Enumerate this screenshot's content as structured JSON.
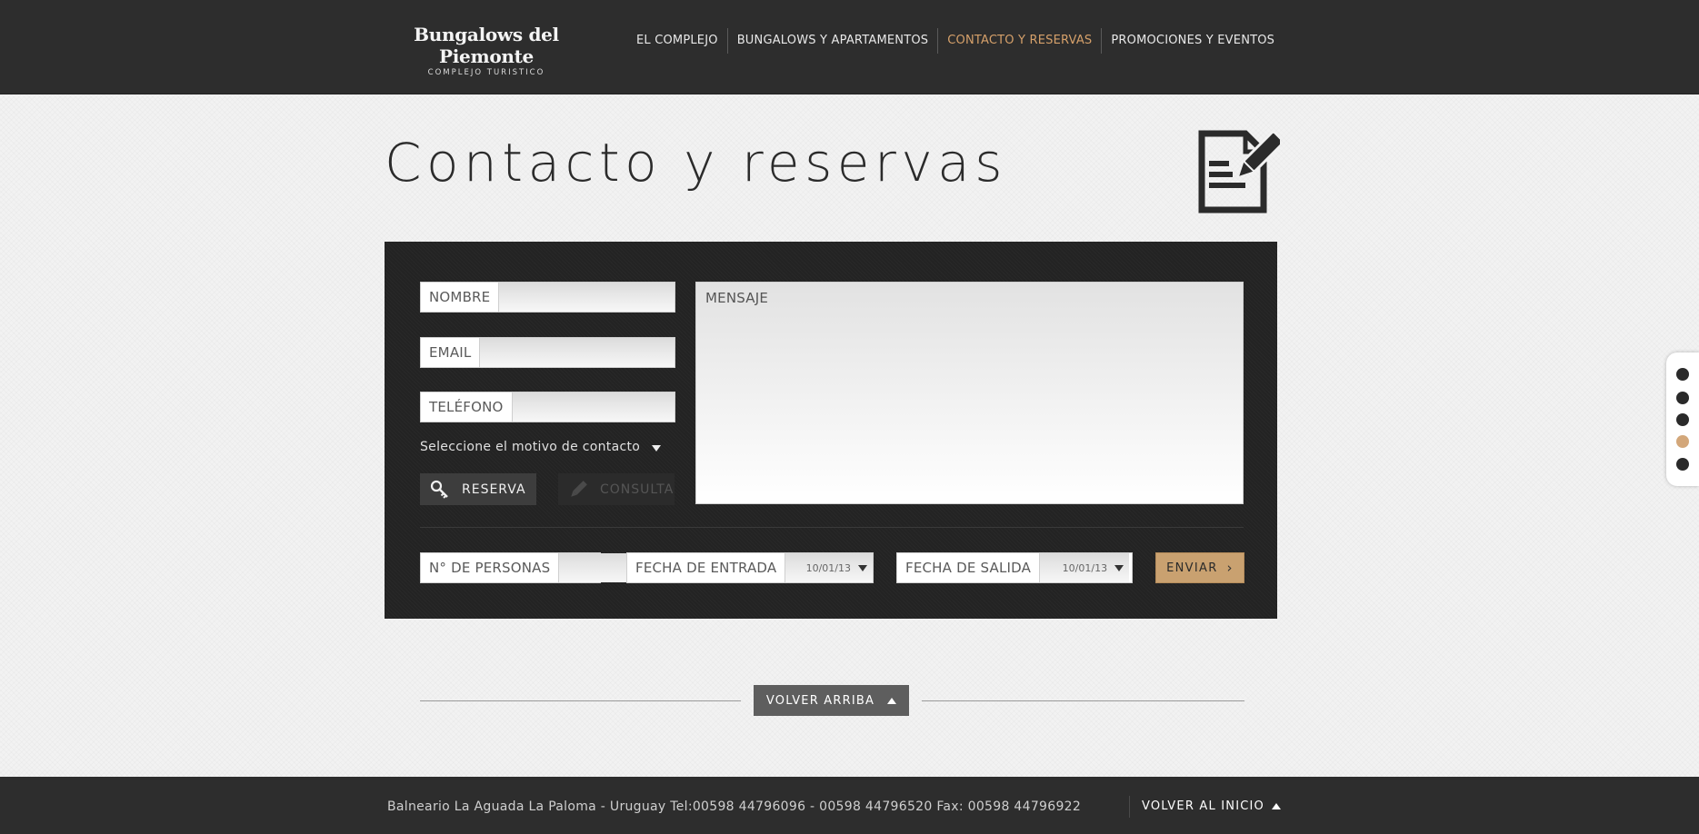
{
  "brand": {
    "name": "Bungalows del Piemonte",
    "tagline": "COMPLEJO TURISTICO"
  },
  "nav": {
    "items": [
      {
        "label": "EL COMPLEJO"
      },
      {
        "label": "BUNGALOWS Y APARTAMENTOS"
      },
      {
        "label": "CONTACTO Y RESERVAS"
      },
      {
        "label": "PROMOCIONES Y EVENTOS"
      }
    ],
    "active_index": 2
  },
  "page": {
    "title": "Contacto y reservas",
    "icon": "edit-document-icon"
  },
  "form": {
    "nombre_label": "NOMBRE",
    "nombre_value": "",
    "email_label": "EMAIL",
    "email_value": "",
    "telefono_label": "TELÉFONO",
    "telefono_value": "",
    "mensaje_placeholder": "MENSAJE",
    "motivo_label": "Seleccione el motivo de contacto",
    "reserva_label": "RESERVA",
    "consulta_label": "CONSULTA",
    "personas_label": "N° DE PERSONAS",
    "personas_value": "",
    "fecha_entrada_label": "FECHA DE ENTRADA",
    "fecha_entrada_value": "10/01/13",
    "fecha_salida_label": "FECHA DE SALIDA",
    "fecha_salida_value": "10/01/13",
    "submit_label": "ENVIAR"
  },
  "back_to_top": {
    "label": "VOLVER ARRIBA"
  },
  "side_nav": {
    "dot_count": 5,
    "active_index": 3
  },
  "footer": {
    "text": "Balneario La Aguada La Paloma - Uruguay Tel:00598 44796096 - 00598 44796520 Fax: 00598 44796922",
    "back_label": "VOLVER AL INICIO"
  },
  "colors": {
    "header_bg": "#2d2d2d",
    "accent": "#d5a06a",
    "panel_bg": "#232323",
    "button_accent": "#c9a170",
    "page_bg": "#f2f2f2"
  }
}
